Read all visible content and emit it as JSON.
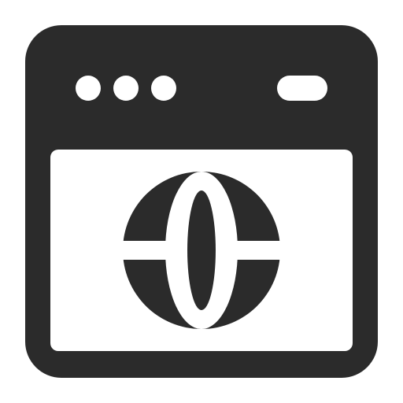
{
  "icon": {
    "name": "web-browser-window-globe-icon",
    "colors": {
      "foreground": "#2b2b2b",
      "background": "#ffffff"
    },
    "window": {
      "control_dots": [
        "dot",
        "dot",
        "dot"
      ],
      "action_pill": "pill"
    },
    "content": {
      "glyph": "globe-icon"
    }
  }
}
